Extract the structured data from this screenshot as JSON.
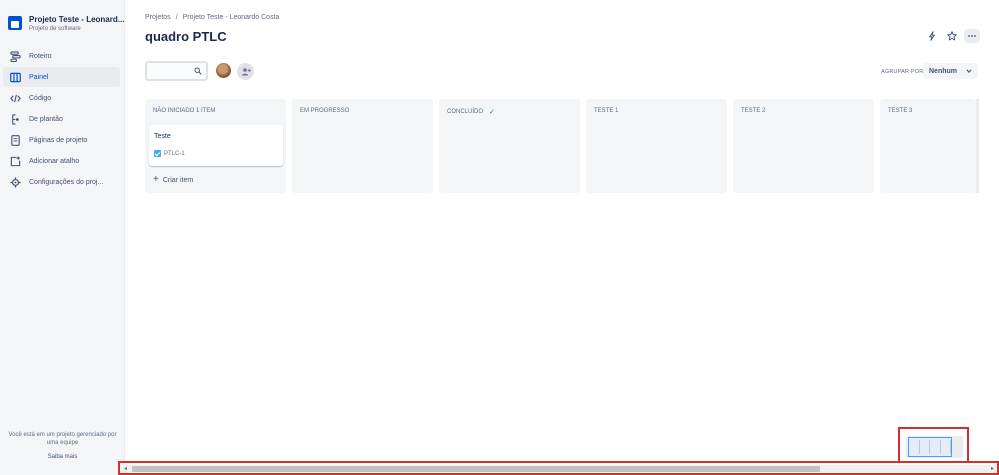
{
  "project": {
    "name": "Projeto Teste - Leonard...",
    "type": "Projeto de software"
  },
  "nav": [
    {
      "label": "Roteiro",
      "icon": "roadmap-icon",
      "active": false
    },
    {
      "label": "Painel",
      "icon": "board-icon",
      "active": true
    },
    {
      "label": "Código",
      "icon": "code-icon",
      "active": false
    },
    {
      "label": "De plantão",
      "icon": "on-call-icon",
      "active": false
    },
    {
      "label": "Páginas de projeto",
      "icon": "pages-icon",
      "active": false
    },
    {
      "label": "Adicionar atalho",
      "icon": "add-shortcut-icon",
      "active": false
    },
    {
      "label": "Configurações do proj...",
      "icon": "gear-icon",
      "active": false
    }
  ],
  "sidebar_footer": {
    "text": "Você está em um projeto gerenciado por uma equipe",
    "link": "Saiba mais"
  },
  "breadcrumb": [
    "Projetos",
    "/",
    "Projeto Teste - Leonardo Costa"
  ],
  "page_title": "quadro PTLC",
  "search": {
    "value": "",
    "placeholder": ""
  },
  "group_by": {
    "label": "AGRUPAR POR",
    "value": "Nenhum"
  },
  "columns": [
    {
      "title": "NÃO INICIADO 1 ITEM",
      "done": false
    },
    {
      "title": "EM PROGRESSO",
      "done": false
    },
    {
      "title": "CONCLUÍDO",
      "done": true
    },
    {
      "title": "TESTE 1",
      "done": false
    },
    {
      "title": "TESTE 2",
      "done": false
    },
    {
      "title": "TESTE 3",
      "done": false
    }
  ],
  "card": {
    "title": "Teste",
    "key": "PTLC-1"
  },
  "create_item": {
    "plus": "+",
    "label": "Criar item"
  },
  "colors": {
    "accent": "#0052cc",
    "done": "#00875a",
    "highlight": "#d32f2f"
  }
}
